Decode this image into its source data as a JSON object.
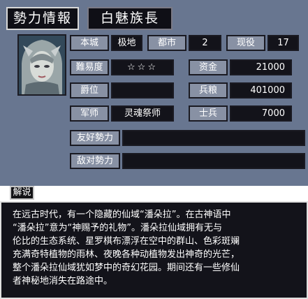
{
  "header": {
    "title": "勢力情報",
    "name": "白魅族長"
  },
  "portrait": {
    "icon": "leader-portrait"
  },
  "info": {
    "castle_label": "本城",
    "castle_value": "极地",
    "city_label": "都市",
    "city_value": "2",
    "officers_label": "现役",
    "officers_value": "17",
    "difficulty_label": "難易度",
    "difficulty_value": "☆☆☆",
    "funds_label": "资金",
    "funds_value": "21000",
    "rank_label": "爵位",
    "rank_value": "",
    "food_label": "兵粮",
    "food_value": "401000",
    "strategist_label": "军师",
    "strategist_value": "灵魂祭师",
    "soldiers_label": "士兵",
    "soldiers_value": "7000",
    "friendly_label": "友好勢力",
    "friendly_value": "",
    "hostile_label": "敌对勢力",
    "hostile_value": ""
  },
  "explanation": {
    "label": "解说",
    "lines": [
      "在远古时代，有一个隐藏的仙域“潘朵拉”。在古神语中",
      "“潘朵拉”意为“神赐予的礼物”。潘朵拉仙域拥有无与",
      "伦比的生态系统、星罗棋布漂浮在空中的群山、色彩斑斓",
      "充满奇特植物的雨林、夜晚各种动植物发出神奇的光芒，",
      "整个潘朵拉仙域犹如梦中的奇幻花园。期间还有一些修仙",
      "者神秘地消失在路途中。"
    ]
  }
}
